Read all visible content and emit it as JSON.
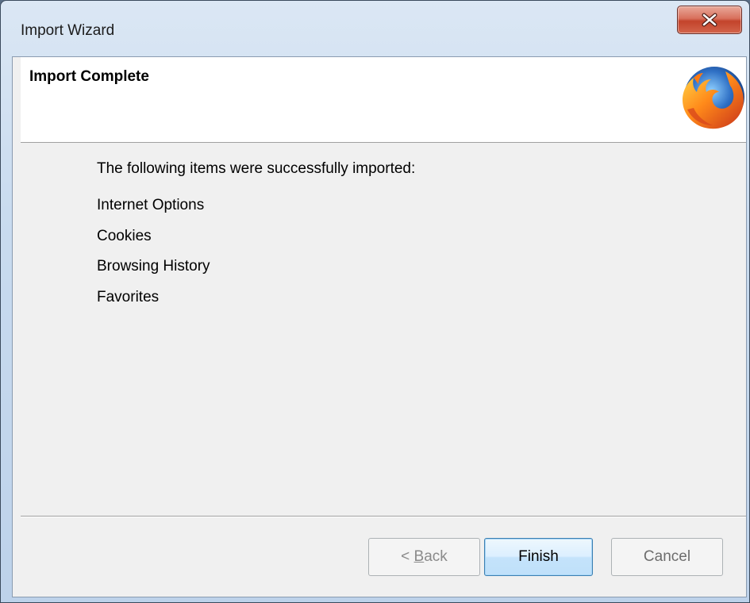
{
  "window": {
    "title": "Import Wizard",
    "close_icon": "close-icon"
  },
  "header": {
    "title": "Import Complete",
    "logo_icon": "firefox-logo-icon"
  },
  "content": {
    "intro": "The following items were successfully imported:",
    "items": [
      "Internet Options",
      "Cookies",
      "Browsing History",
      "Favorites"
    ]
  },
  "buttons": {
    "back_prefix": "< ",
    "back_accel": "B",
    "back_rest": "ack",
    "back_enabled": false,
    "finish_label": "Finish",
    "finish_default": true,
    "cancel_label": "Cancel",
    "cancel_enabled": false
  },
  "colors": {
    "close_button": "#c3432b",
    "default_button_border": "#3c7fb1",
    "dialog_background": "#f0f0f0",
    "header_background": "#ffffff"
  }
}
